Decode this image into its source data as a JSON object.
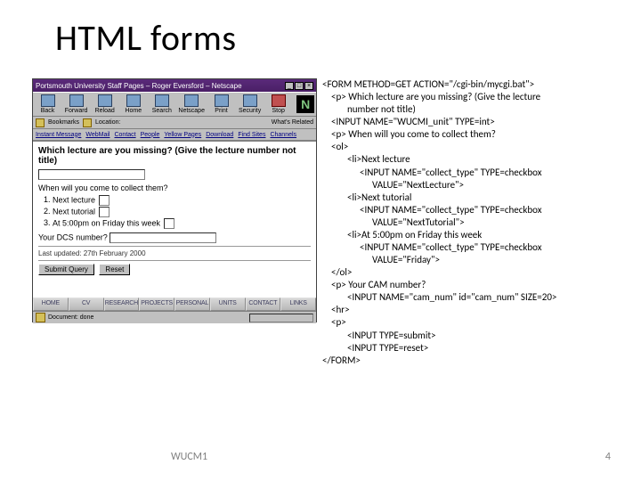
{
  "title": "HTML forms",
  "browser": {
    "window_title": "Portsmouth University Staff Pages – Roger Eversford – Netscape",
    "toolbar_buttons": [
      "Back",
      "Forward",
      "Reload",
      "Home",
      "Search",
      "Netscape",
      "Print",
      "Security",
      "Stop"
    ],
    "netscape_logo": "N",
    "bookmarks_label": "Bookmarks",
    "location_label": "Location:",
    "what_related": "What's Related",
    "quicklinks": [
      "Instant Message",
      "WebMail",
      "Contact",
      "People",
      "Yellow Pages",
      "Download",
      "Find Sites",
      "Channels"
    ],
    "page": {
      "heading": "Which lecture are you missing? (Give the lecture number not title)",
      "q2": "When will you come to collect them?",
      "options": [
        "Next lecture",
        "Next tutorial",
        "At 5:00pm on Friday this week"
      ],
      "q3": "Your DCS number?",
      "last_updated": "Last updated: 27th February 2000",
      "submit": "Submit Query",
      "reset": "Reset"
    },
    "bottom_tabs": [
      "HOME",
      "CV",
      "RESEARCH",
      "PROJECTS",
      "PERSONAL",
      "UNITS",
      "CONTACT",
      "LINKS"
    ],
    "status_text": "Document: done"
  },
  "code_lines": [
    {
      "t": "<FORM METHOD=GET ACTION=\"/cgi-bin/mycgi.bat\">",
      "i": 0
    },
    {
      "t": "<p> Which lecture are you missing? (Give the lecture",
      "i": 1
    },
    {
      "t": "number not title)",
      "i": 2
    },
    {
      "t": "<INPUT NAME=\"WUCMI_unit\" TYPE=int>",
      "i": 1
    },
    {
      "t": "<p> When will you come to collect them?",
      "i": 1
    },
    {
      "t": "<ol>",
      "i": 1
    },
    {
      "t": "<li>Next lecture",
      "i": 2
    },
    {
      "t": "<INPUT NAME=\"collect_type\" TYPE=checkbox",
      "i": 3
    },
    {
      "t": "VALUE=\"NextLecture\">",
      "i": 4
    },
    {
      "t": "<li>Next tutorial",
      "i": 2
    },
    {
      "t": "<INPUT NAME=\"collect_type\" TYPE=checkbox",
      "i": 3
    },
    {
      "t": "VALUE=\"NextTutorial\">",
      "i": 4
    },
    {
      "t": "<li>At 5:00pm on Friday this week",
      "i": 2
    },
    {
      "t": "<INPUT NAME=\"collect_type\" TYPE=checkbox",
      "i": 3
    },
    {
      "t": "VALUE=\"Friday\">",
      "i": 4
    },
    {
      "t": "</ol>",
      "i": 1
    },
    {
      "t": "<p> Your CAM number?",
      "i": 1
    },
    {
      "t": "<INPUT NAME=\"cam_num\" id=\"cam_num\" SIZE=20>",
      "i": 2
    },
    {
      "t": "<hr>",
      "i": 1
    },
    {
      "t": "<p>",
      "i": 1
    },
    {
      "t": "<INPUT TYPE=submit>",
      "i": 2
    },
    {
      "t": "<INPUT TYPE=reset>",
      "i": 2
    },
    {
      "t": "</FORM>",
      "i": 0
    }
  ],
  "footer": {
    "label": "WUCM1",
    "page": "4"
  }
}
